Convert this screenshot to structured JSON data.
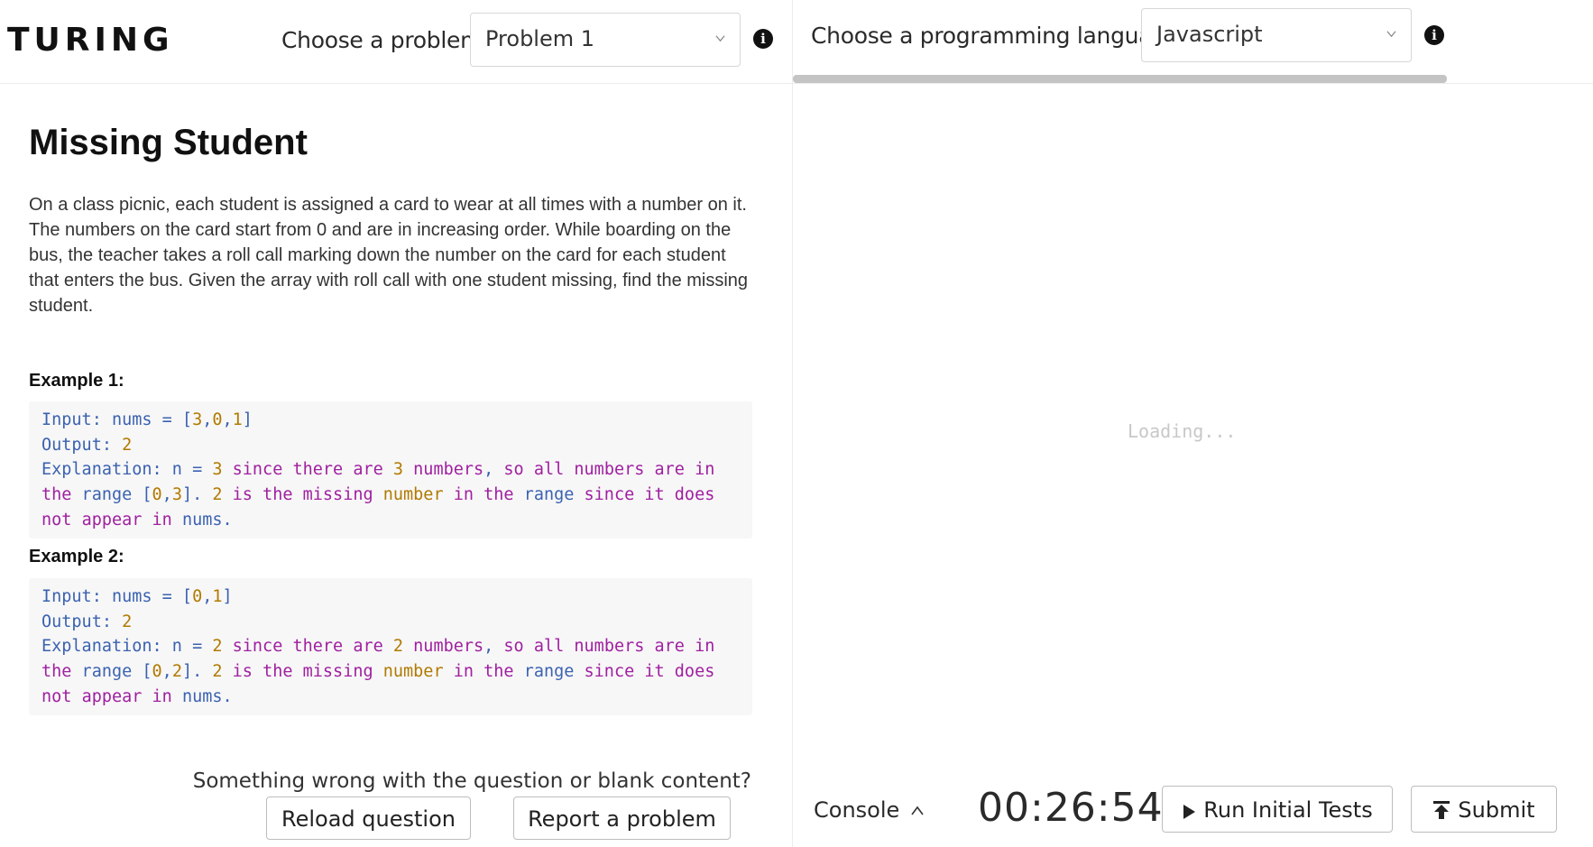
{
  "brand": {
    "logo": "TURING"
  },
  "header": {
    "problem_label": "Choose a problem",
    "problem_selected": "Problem 1",
    "language_label": "Choose a programming language",
    "language_selected": "Javascript"
  },
  "problem": {
    "title": "Missing Student",
    "description": "On a class picnic, each student is assigned a card to wear at all times with a number on it. The numbers on the card start from 0 and are in increasing order. While boarding on the bus, the teacher takes a roll call marking down the number on the card for each student that enters the bus. Given the array with roll call with one student missing, find the missing student.",
    "examples": [
      {
        "heading": "Example 1:",
        "input": "Input: nums = [3,0,1]",
        "output": "Output: 2",
        "explanation": "Explanation: n = 3 since there are 3 numbers, so all numbers are in the range [0,3]. 2 is the missing number in the range since it does not appear in nums."
      },
      {
        "heading": "Example 2:",
        "input": "Input: nums = [0,1]",
        "output": "Output: 2",
        "explanation": "Explanation: n = 2 since there are 2 numbers, so all numbers are in the range [0,2]. 2 is the missing number in the range since it does not appear in nums."
      }
    ]
  },
  "footer_left": {
    "prompt": "Something wrong with the question or blank content?",
    "reload_label": "Reload question",
    "report_label": "Report a problem"
  },
  "editor": {
    "loading_text": "Loading..."
  },
  "footer_right": {
    "console_label": "Console",
    "timer": "00:26:54",
    "run_label": "Run Initial Tests",
    "submit_label": "Submit"
  },
  "icons": [
    "chevron-down-icon",
    "info-icon",
    "chevron-up-icon",
    "play-icon",
    "upload-icon"
  ]
}
